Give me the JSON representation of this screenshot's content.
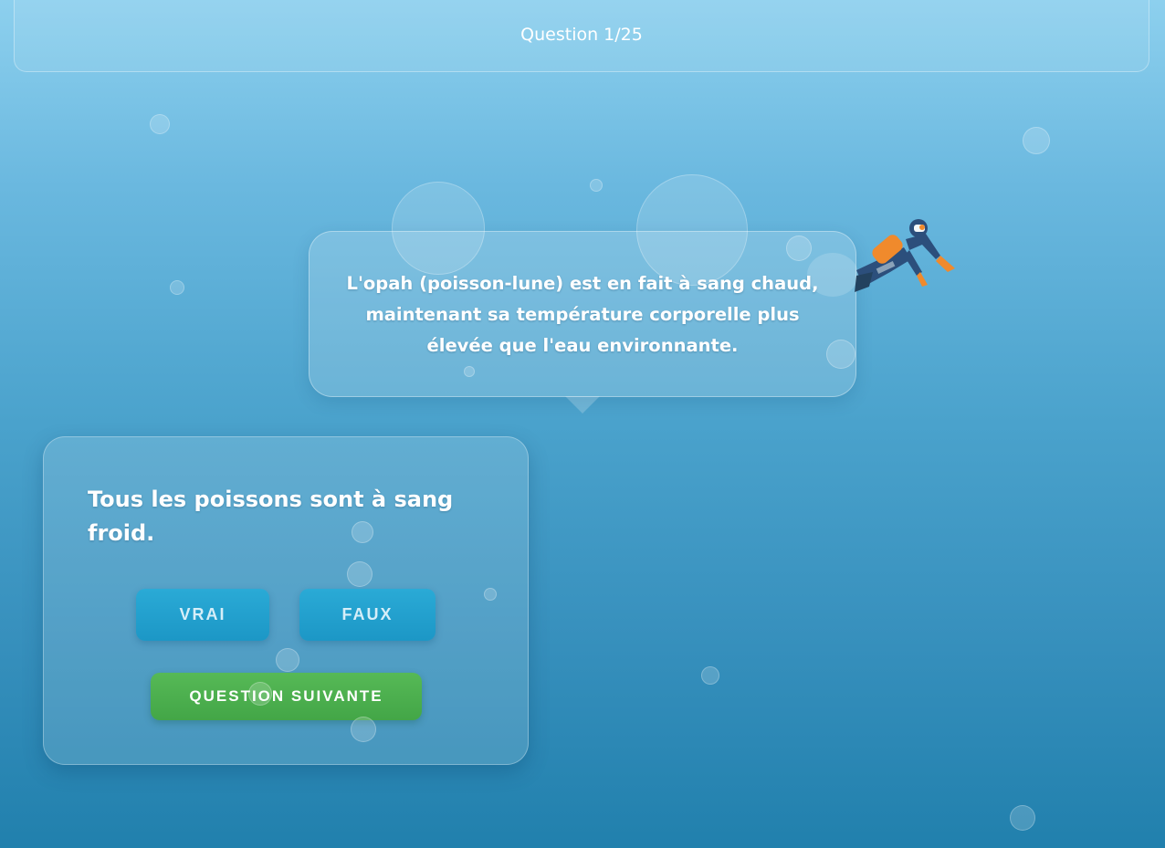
{
  "header": {
    "question_counter": "Question 1/25"
  },
  "speech_bubble": {
    "text": "L'opah (poisson-lune) est en fait à sang chaud, maintenant sa température corporelle plus élevée que l'eau environnante."
  },
  "quiz": {
    "statement": "Tous les poissons sont à sang froid.",
    "true_label": "VRAI",
    "false_label": "FAUX",
    "next_label": "QUESTION SUIVANTE"
  },
  "colors": {
    "background_top": "#8dd0ee",
    "background_bottom": "#2180ad",
    "answer_button": "#1c97c6",
    "next_button": "#43a647",
    "diver_suit": "#2c4f7c",
    "diver_tank": "#f08a2c"
  },
  "icons": {
    "diver": "scuba-diver-illustration",
    "bubbles": "air-bubble"
  }
}
